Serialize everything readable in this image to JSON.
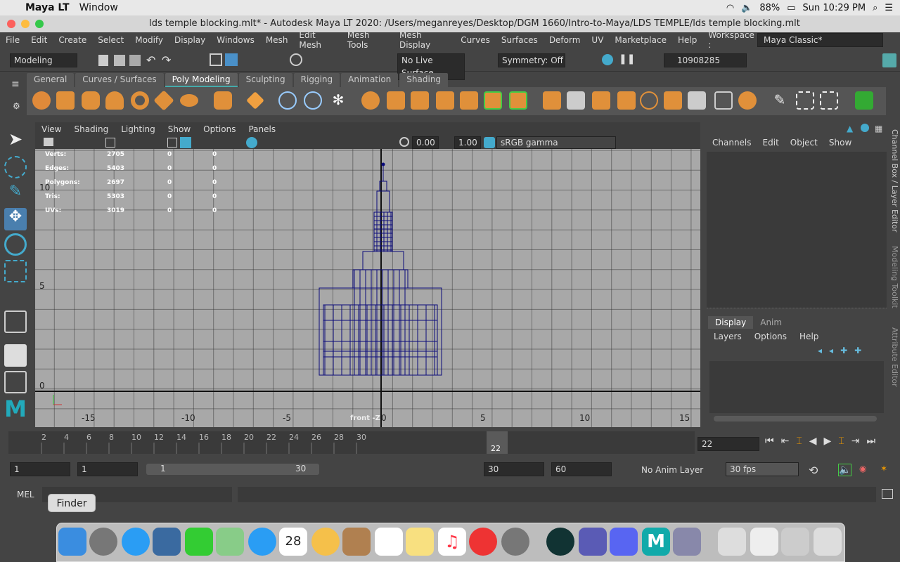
{
  "menubar": {
    "app": "Maya LT",
    "window": "Window",
    "battery": "88%",
    "clock": "Sun 10:29 PM"
  },
  "title": "lds temple blocking.mlt* - Autodesk Maya LT 2020: /Users/meganreyes/Desktop/DGM 1660/Intro-to-Maya/LDS TEMPLE/lds temple blocking.mlt",
  "menu": [
    "File",
    "Edit",
    "Create",
    "Select",
    "Modify",
    "Display",
    "Windows",
    "Mesh",
    "Edit Mesh",
    "Mesh Tools",
    "Mesh Display",
    "Curves",
    "Surfaces",
    "Deform",
    "UV",
    "Marketplace",
    "Help"
  ],
  "workspace": {
    "label": "Workspace :",
    "value": "Maya Classic*"
  },
  "status": {
    "mode": "Modeling",
    "live": "No Live Surface",
    "symmetry": "Symmetry: Off",
    "user": "10908285"
  },
  "shelf_tabs": [
    "General",
    "Curves / Surfaces",
    "Poly Modeling",
    "Sculpting",
    "Rigging",
    "Animation",
    "Shading"
  ],
  "viewport": {
    "menu": [
      "View",
      "Shading",
      "Lighting",
      "Show",
      "Options",
      "Panels"
    ],
    "exposure": "0.00",
    "gamma": "1.00",
    "colorspace": "sRGB gamma",
    "camera": "front -Z"
  },
  "hud": [
    {
      "k": "Verts:",
      "a": "2705",
      "b": "0",
      "c": "0"
    },
    {
      "k": "Edges:",
      "a": "5403",
      "b": "0",
      "c": "0"
    },
    {
      "k": "Polygons:",
      "a": "2697",
      "b": "0",
      "c": "0"
    },
    {
      "k": "Tris:",
      "a": "5303",
      "b": "0",
      "c": "0"
    },
    {
      "k": "UVs:",
      "a": "3019",
      "b": "0",
      "c": "0"
    }
  ],
  "axis_x": [
    "-15",
    "-10",
    "-5",
    "0",
    "5",
    "10",
    "15"
  ],
  "axis_y": [
    "10",
    "5",
    "0"
  ],
  "channelbox": {
    "menu": [
      "Channels",
      "Edit",
      "Object",
      "Show"
    ],
    "tabs": [
      "Display",
      "Anim"
    ],
    "sub": [
      "Layers",
      "Options",
      "Help"
    ]
  },
  "side_tabs": [
    "Channel Box / Layer Editor",
    "Modeling Toolkit",
    "Attribute Editor"
  ],
  "timeline": {
    "ticks": [
      "2",
      "4",
      "6",
      "8",
      "10",
      "12",
      "14",
      "16",
      "18",
      "20",
      "22",
      "24",
      "26",
      "28",
      "30"
    ],
    "current": "22",
    "field": "22"
  },
  "range": {
    "start": "1",
    "start2": "1",
    "slider_start": "1",
    "slider_end": "30",
    "end": "30",
    "end2": "60",
    "anim_layer": "No Anim Layer",
    "fps": "30 fps"
  },
  "cmd": {
    "label": "MEL"
  },
  "dock_tooltip": "Finder",
  "colors": {
    "mesh": "#0a0a7a",
    "grid": "#2a2a2a",
    "accent": "#4aa"
  }
}
